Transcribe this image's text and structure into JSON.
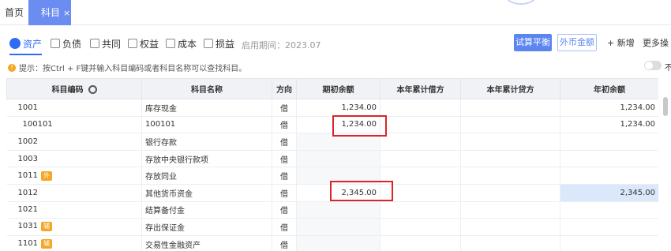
{
  "tabs": {
    "home": "首页",
    "active": "科目",
    "close": "×"
  },
  "categories": [
    {
      "label": "资产",
      "icon": "asset-icon"
    },
    {
      "label": "负债",
      "icon": "liability-icon"
    },
    {
      "label": "共同",
      "icon": "common-icon"
    },
    {
      "label": "权益",
      "icon": "equity-icon"
    },
    {
      "label": "成本",
      "icon": "cost-icon"
    },
    {
      "label": "损益",
      "icon": "profit-loss-icon"
    }
  ],
  "period": "启用期间：2023.07",
  "buttons": {
    "trial_balance": "试算平衡",
    "fx_amount": "外币金额",
    "add": "+ 新增",
    "more": "更多操"
  },
  "hint": "提示：按Ctrl + F键并输入科目编码或者科目名称可以查找科目。",
  "toggle_label": "不",
  "columns": [
    "科目编码",
    "科目名称",
    "方向",
    "期初余额",
    "本年累计借方",
    "本年累计贷方",
    "年初余额"
  ],
  "rows": [
    {
      "code": "1001",
      "name": "库存现金",
      "dir": "借",
      "opening": "1,234.00",
      "debit": "",
      "credit": "",
      "year_start": "1,234.00",
      "badge": ""
    },
    {
      "code": "100101",
      "name": "100101",
      "dir": "借",
      "opening": "1,234.00",
      "debit": "",
      "credit": "",
      "year_start": "1,234.00",
      "badge": "",
      "sub": true
    },
    {
      "code": "1002",
      "name": "银行存款",
      "dir": "借",
      "opening": "",
      "debit": "",
      "credit": "",
      "year_start": "",
      "badge": ""
    },
    {
      "code": "1003",
      "name": "存放中央银行款项",
      "dir": "借",
      "opening": "",
      "debit": "",
      "credit": "",
      "year_start": "",
      "badge": ""
    },
    {
      "code": "1011",
      "name": "存放同业",
      "dir": "借",
      "opening": "",
      "debit": "",
      "credit": "",
      "year_start": "",
      "badge": "外"
    },
    {
      "code": "1012",
      "name": "其他货币资金",
      "dir": "借",
      "opening": "2,345.00",
      "debit": "",
      "credit": "",
      "year_start": "2,345.00",
      "badge": ""
    },
    {
      "code": "1021",
      "name": "结算备付金",
      "dir": "借",
      "opening": "",
      "debit": "",
      "credit": "",
      "year_start": "",
      "badge": ""
    },
    {
      "code": "1031",
      "name": "存出保证金",
      "dir": "借",
      "opening": "",
      "debit": "",
      "credit": "",
      "year_start": "",
      "badge": "辅"
    },
    {
      "code": "1101",
      "name": "交易性金融资产",
      "dir": "借",
      "opening": "",
      "debit": "",
      "credit": "",
      "year_start": "",
      "badge": "辅"
    }
  ]
}
